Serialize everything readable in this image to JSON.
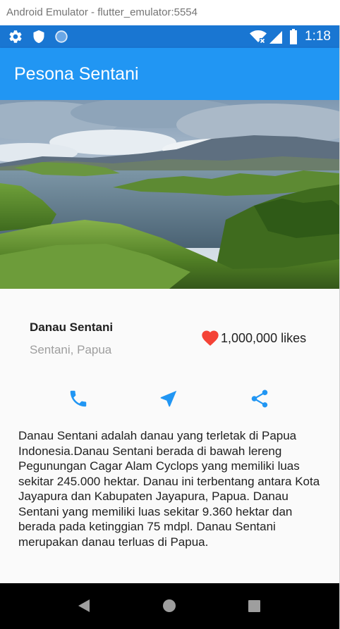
{
  "window": {
    "title": "Android Emulator - flutter_emulator:5554"
  },
  "status_bar": {
    "time": "1:18",
    "left_icons": [
      "settings-icon",
      "shield-icon",
      "circle-icon"
    ],
    "right_icons": [
      "wifi-icon",
      "signal-icon",
      "battery-icon"
    ]
  },
  "app_bar": {
    "title": "Pesona Sentani"
  },
  "title_section": {
    "name": "Danau Sentani",
    "location": "Sentani, Papua",
    "likes": "1,000,000 likes"
  },
  "actions": [
    {
      "icon": "phone-icon"
    },
    {
      "icon": "navigation-icon"
    },
    {
      "icon": "share-icon"
    }
  ],
  "description": "Danau Sentani adalah danau yang terletak di Papua Indonesia.Danau Sentani berada di bawah lereng Pegunungan Cagar Alam Cyclops yang memiliki luas sekitar 245.000 hektar. Danau ini terbentang antara Kota Jayapura dan Kabupaten Jayapura, Papua. Danau Sentani yang memiliki luas sekitar 9.360 hektar dan berada pada ketinggian 75 mdpl. Danau Sentani merupakan danau terluas di Papua.",
  "colors": {
    "primary": "#2196f3",
    "status_bar": "#1976d2",
    "heart": "#f44336",
    "action": "#2196f3"
  }
}
